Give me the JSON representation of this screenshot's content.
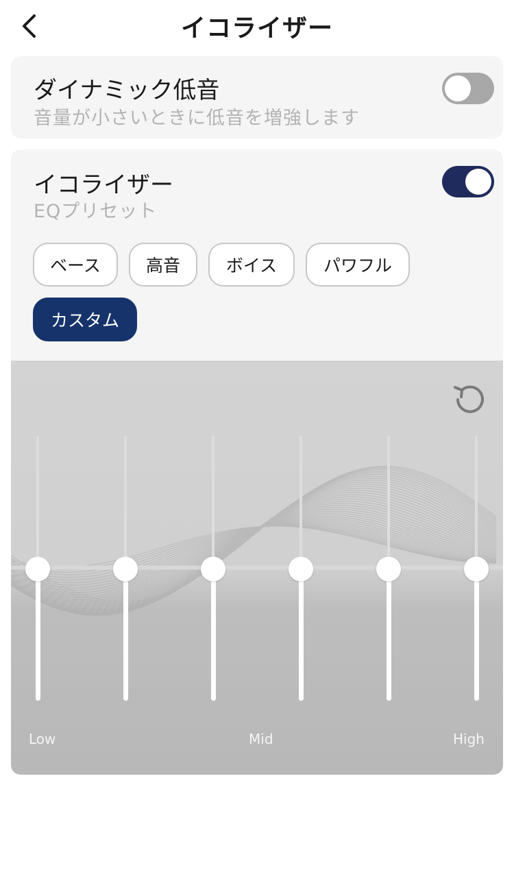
{
  "header": {
    "title": "イコライザー",
    "back_icon": "chevron-left-icon"
  },
  "dynamic_bass": {
    "title": "ダイナミック低音",
    "subtitle": "音量が小さいときに低音を増強します",
    "enabled": false
  },
  "equalizer": {
    "title": "イコライザー",
    "subtitle": "EQプリセット",
    "enabled": true,
    "presets": [
      {
        "label": "ベース",
        "selected": false
      },
      {
        "label": "高音",
        "selected": false
      },
      {
        "label": "ボイス",
        "selected": false
      },
      {
        "label": "パワフル",
        "selected": false
      },
      {
        "label": "カスタム",
        "selected": true
      }
    ],
    "reset_icon": "reset-icon",
    "band_levels": [
      0,
      0,
      0,
      0,
      0,
      0
    ],
    "band_labels": {
      "low": "Low",
      "mid": "Mid",
      "high": "High"
    }
  },
  "colors": {
    "accent": "#16346b",
    "toggle_on": "#1f2b5c",
    "toggle_off": "#a8a8a8",
    "card_bg": "#f5f5f5",
    "subtitle": "#b3b3b3"
  }
}
